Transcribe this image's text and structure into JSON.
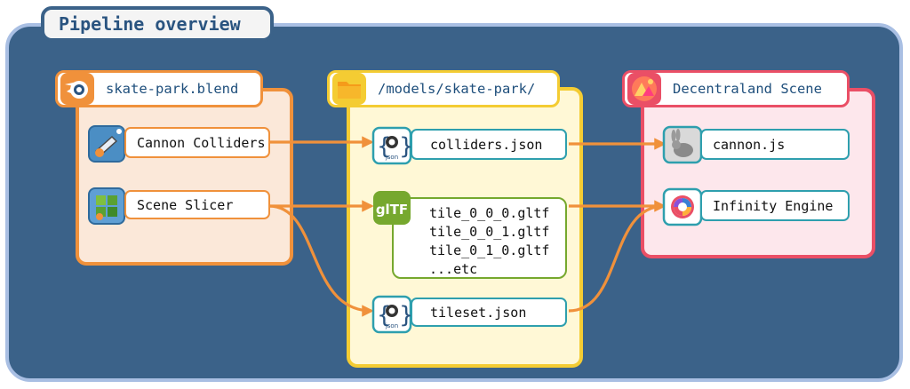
{
  "title": "Pipeline overview",
  "groups": {
    "blend": {
      "label": "skate-park.blend",
      "color": "#f0913b"
    },
    "models": {
      "label": "/models/skate-park/",
      "color": "#f4cc33"
    },
    "decentraland": {
      "label": "Decentraland Scene",
      "color": "#ea4f66"
    }
  },
  "nodes": {
    "cannon_colliders": "Cannon Colliders",
    "scene_slicer": "Scene Slicer",
    "colliders_json": "colliders.json",
    "gltf_files": [
      "tile_0_0_0.gltf",
      "tile_0_0_1.gltf",
      "tile_0_1_0.gltf",
      "...etc"
    ],
    "tileset_json": "tileset.json",
    "cannon_js": "cannon.js",
    "infinity_engine": "Infinity Engine"
  },
  "icons": {
    "blend": "blender-icon",
    "models": "folder-icon",
    "decentraland": "decentraland-icon",
    "cannon_colliders": "cannon-addon-icon",
    "scene_slicer": "slicer-addon-icon",
    "colliders_json": "json-icon",
    "gltf": "gltf-icon",
    "tileset_json": "json-icon",
    "cannon_js": "bunny-icon",
    "infinity_engine": "infinity-engine-icon"
  },
  "json_icon_text": "json",
  "gltf_icon_text": "glTF",
  "colors": {
    "arrow": "#f0913b",
    "frame": "#3b6289"
  }
}
